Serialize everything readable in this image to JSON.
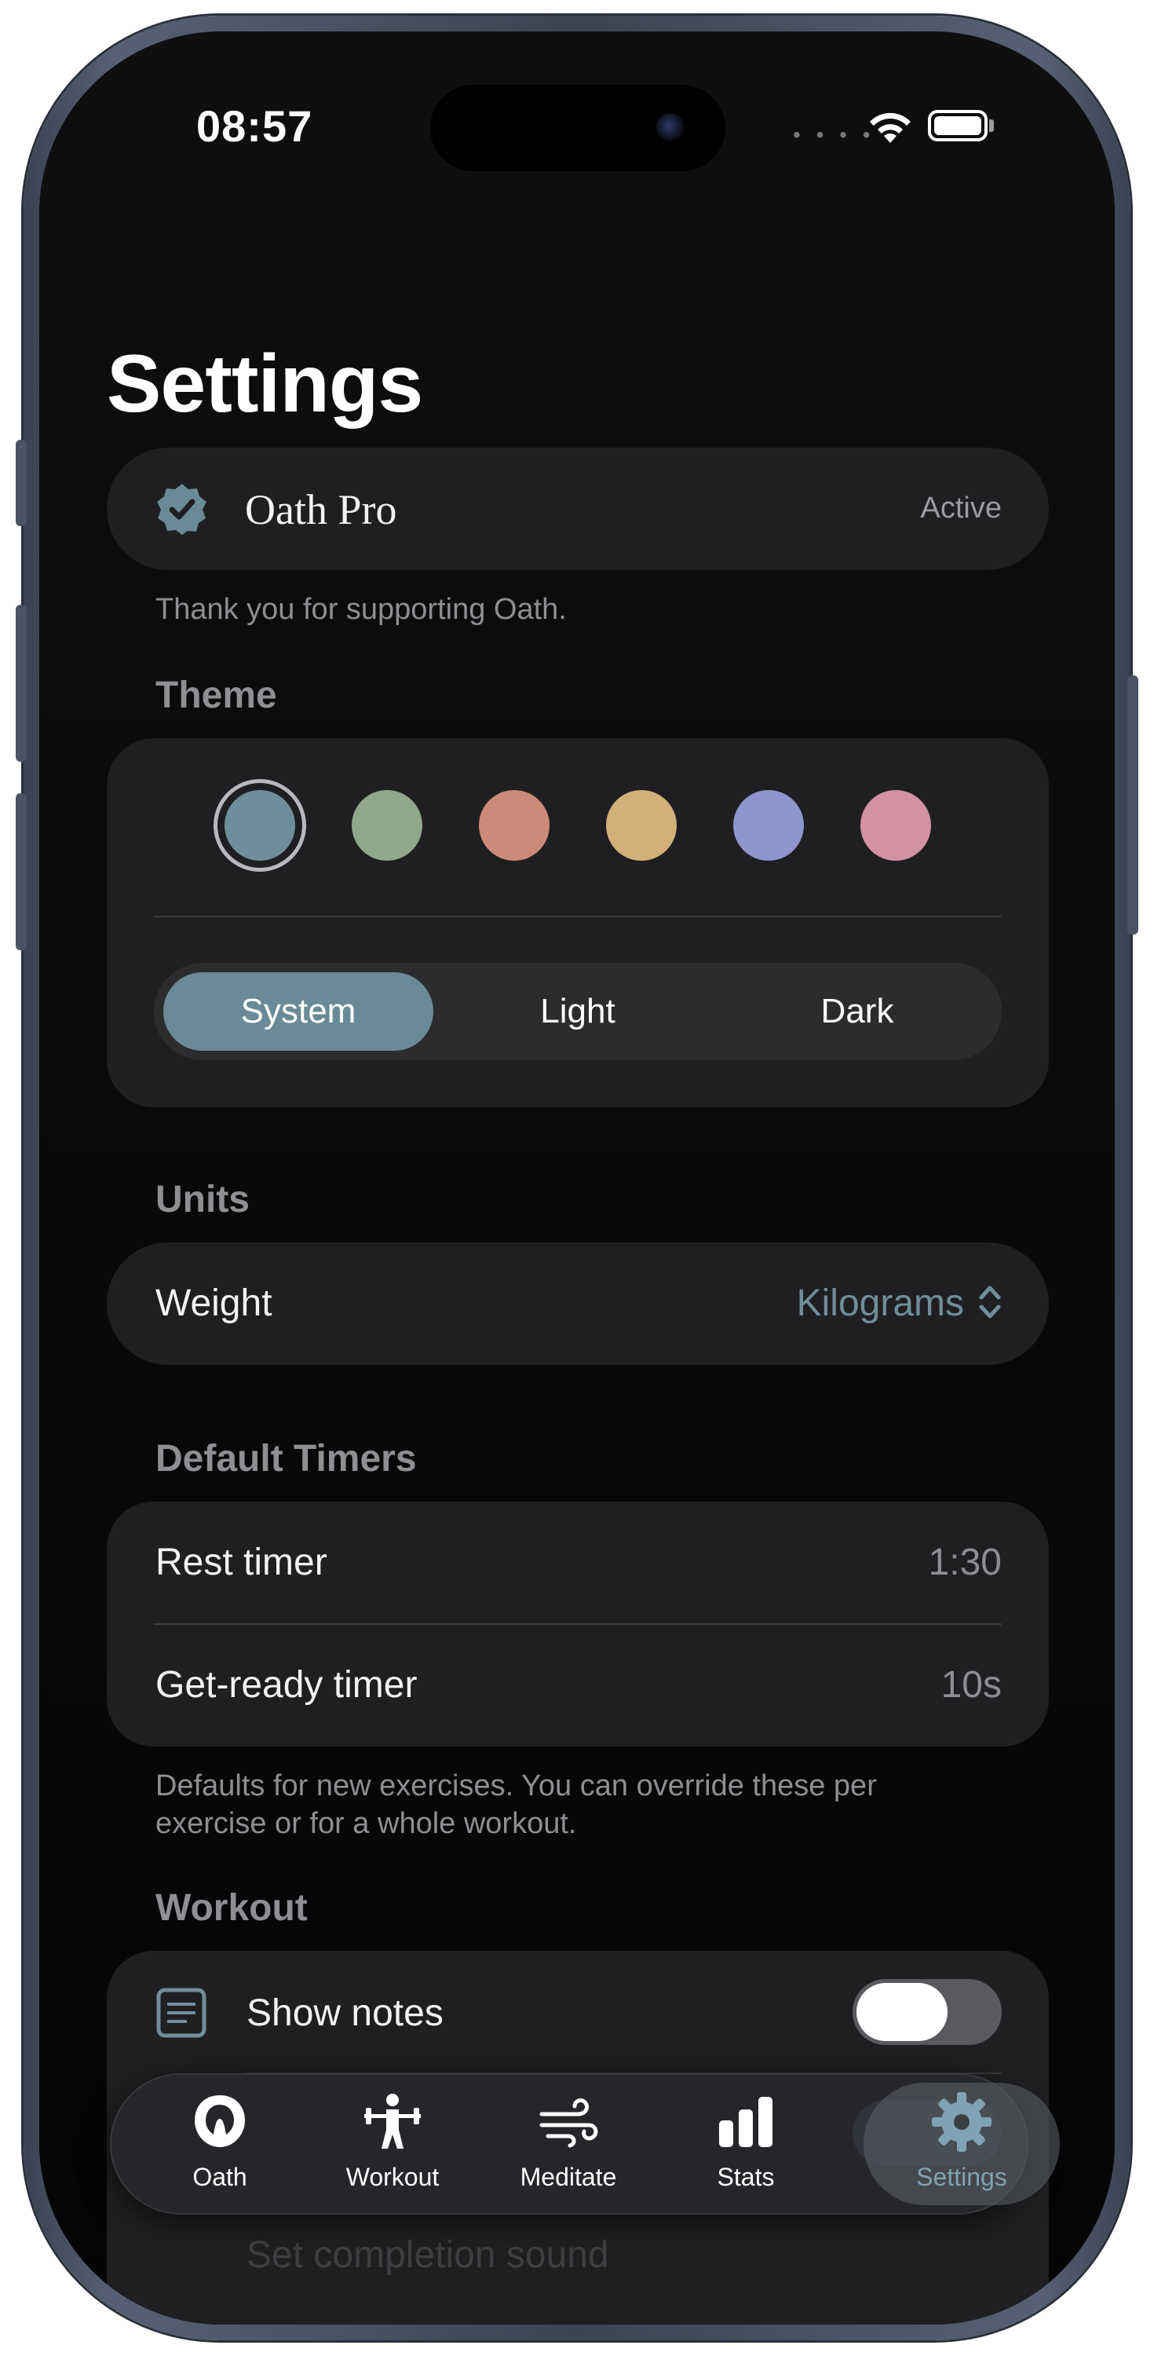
{
  "status_bar": {
    "time": "08:57"
  },
  "page": {
    "title": "Settings"
  },
  "pro": {
    "name": "Oath Pro",
    "status": "Active",
    "note": "Thank you for supporting Oath."
  },
  "theme": {
    "heading": "Theme",
    "swatches": [
      {
        "name": "slate",
        "color": "#6e8e9b",
        "selected": true
      },
      {
        "name": "sage",
        "color": "#8fa88a"
      },
      {
        "name": "terracotta",
        "color": "#cc8a78"
      },
      {
        "name": "sand",
        "color": "#d3b07a"
      },
      {
        "name": "periwinkle",
        "color": "#8e95cc"
      },
      {
        "name": "rose",
        "color": "#d392a4"
      }
    ],
    "modes": [
      "System",
      "Light",
      "Dark"
    ],
    "selected_mode": "System"
  },
  "units": {
    "heading": "Units",
    "weight_label": "Weight",
    "weight_value": "Kilograms"
  },
  "timers": {
    "heading": "Default Timers",
    "rest_label": "Rest timer",
    "rest_value": "1:30",
    "ready_label": "Get-ready timer",
    "ready_value": "10s",
    "note": "Defaults for new exercises. You can override these per exercise or for a whole workout."
  },
  "workout": {
    "heading": "Workout",
    "show_notes_label": "Show notes",
    "show_notes_on": false,
    "completion_sound_label": "Set completion sound"
  },
  "tabs": [
    {
      "label": "Oath",
      "icon": "oath-logo-icon"
    },
    {
      "label": "Workout",
      "icon": "weightlifter-icon"
    },
    {
      "label": "Meditate",
      "icon": "wind-icon"
    },
    {
      "label": "Stats",
      "icon": "bar-chart-icon"
    },
    {
      "label": "Settings",
      "icon": "gear-icon",
      "active": true
    }
  ],
  "colors": {
    "accent": "#6a8a97",
    "active_tab": "#7fa3b5",
    "card": "#1f1f21"
  }
}
